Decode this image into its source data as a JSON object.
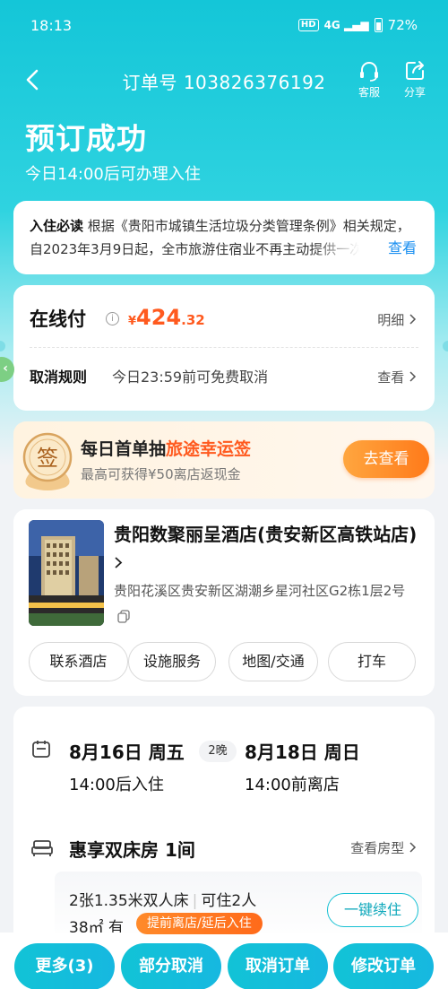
{
  "status_bar": {
    "time": "18:13",
    "hd": "HD",
    "network": "4G",
    "battery": "72%"
  },
  "nav": {
    "order_number": "订单号 103826376192",
    "service_label": "客服",
    "share_label": "分享"
  },
  "header": {
    "title": "预订成功",
    "subtitle": "今日14:00后可办理入住"
  },
  "notice": {
    "label": "入住必读",
    "text": "根据《贵阳市城镇生活垃圾分类管理条例》相关规定，自2023年3月9日起，全市旅游住宿业不再主动提供一次性日用品",
    "link": "查看"
  },
  "payment": {
    "label": "在线付",
    "info_icon": "i",
    "currency": "¥",
    "amount_int": "424",
    "amount_dec": ".32",
    "detail_link": "明细",
    "cancel_label": "取消规则",
    "cancel_text": "今日23:59前可免费取消",
    "cancel_link": "查看"
  },
  "promo": {
    "seal_char": "签",
    "title_prefix": "每日首单抽",
    "title_highlight": "旅途幸运签",
    "subtitle": "最高可获得¥50离店返现金",
    "button": "去查看"
  },
  "hotel": {
    "name": "贵阳数聚丽呈酒店(贵安新区高铁站店)",
    "address": "贵阳花溪区贵安新区湖潮乡星河社区G2栋1层2号",
    "buttons": [
      "联系酒店",
      "设施服务",
      "地图/交通",
      "打车"
    ]
  },
  "stay": {
    "checkin_date": "8月16日 周五",
    "nights": "2晚",
    "checkout_date": "8月18日 周日",
    "checkin_time": "14:00后入住",
    "checkout_time": "14:00前离店"
  },
  "room": {
    "name": "惠享双床房  1间",
    "look_link": "查看房型",
    "beds": "2张1.35米双人床",
    "capacity": "可住2人",
    "area": "38㎡  有",
    "renew_button": "一键续住"
  },
  "bottom": {
    "early_tag": "提前离店/延后入住",
    "more": "更多(3)",
    "partial_cancel": "部分取消",
    "cancel_order": "取消订单",
    "modify_order": "修改订单"
  },
  "colors": {
    "brand": "#14c6d8",
    "accent_orange": "#ff5a1f",
    "link_blue": "#1a8ff0"
  }
}
